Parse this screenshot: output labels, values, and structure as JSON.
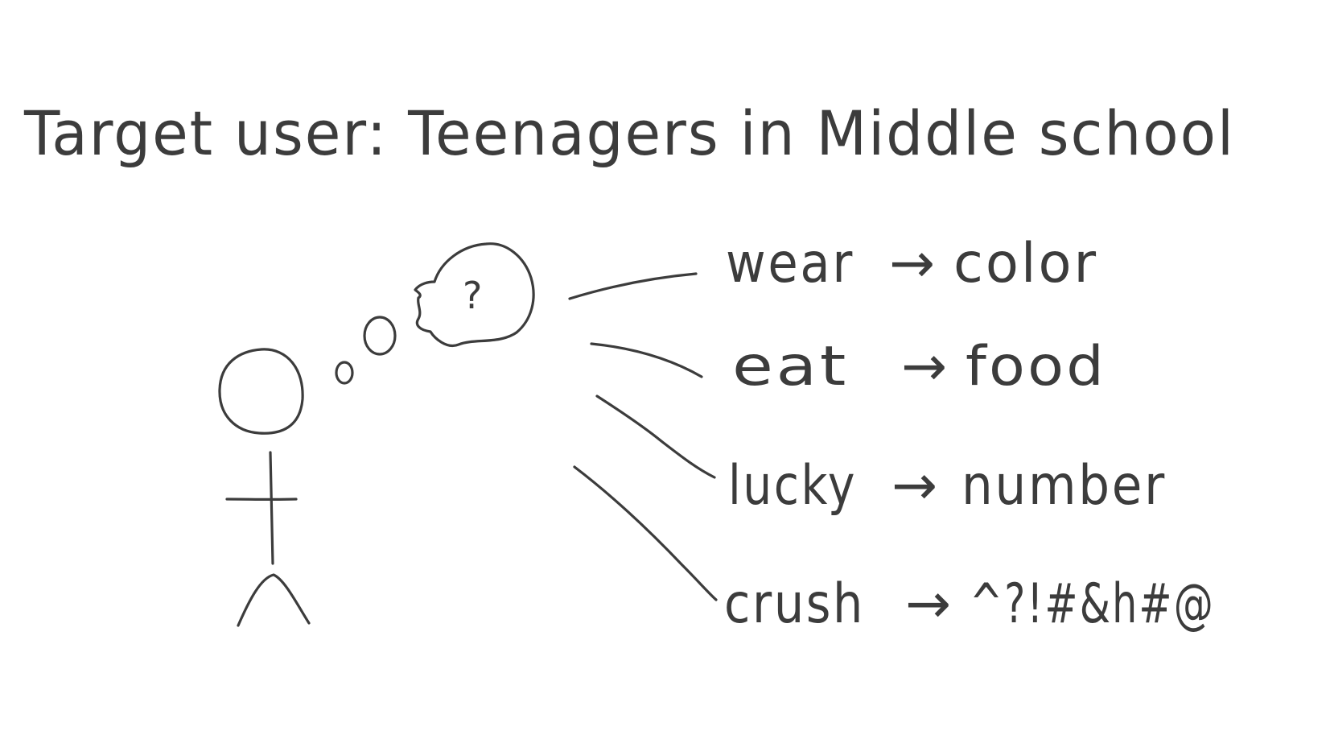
{
  "title": "Target user: Teenagers in Middle school",
  "thought_mark": "?",
  "branches": [
    {
      "verb": "wear",
      "arrow": "→",
      "object": "color"
    },
    {
      "verb": "eat",
      "arrow": "→",
      "object": "food"
    },
    {
      "verb": "lucky",
      "arrow": "→",
      "object": "number"
    },
    {
      "verb": "crush",
      "arrow": "→",
      "object": "^?!#&h#@"
    }
  ],
  "colors": {
    "ink": "#3c3c3c",
    "background": "#ffffff"
  }
}
